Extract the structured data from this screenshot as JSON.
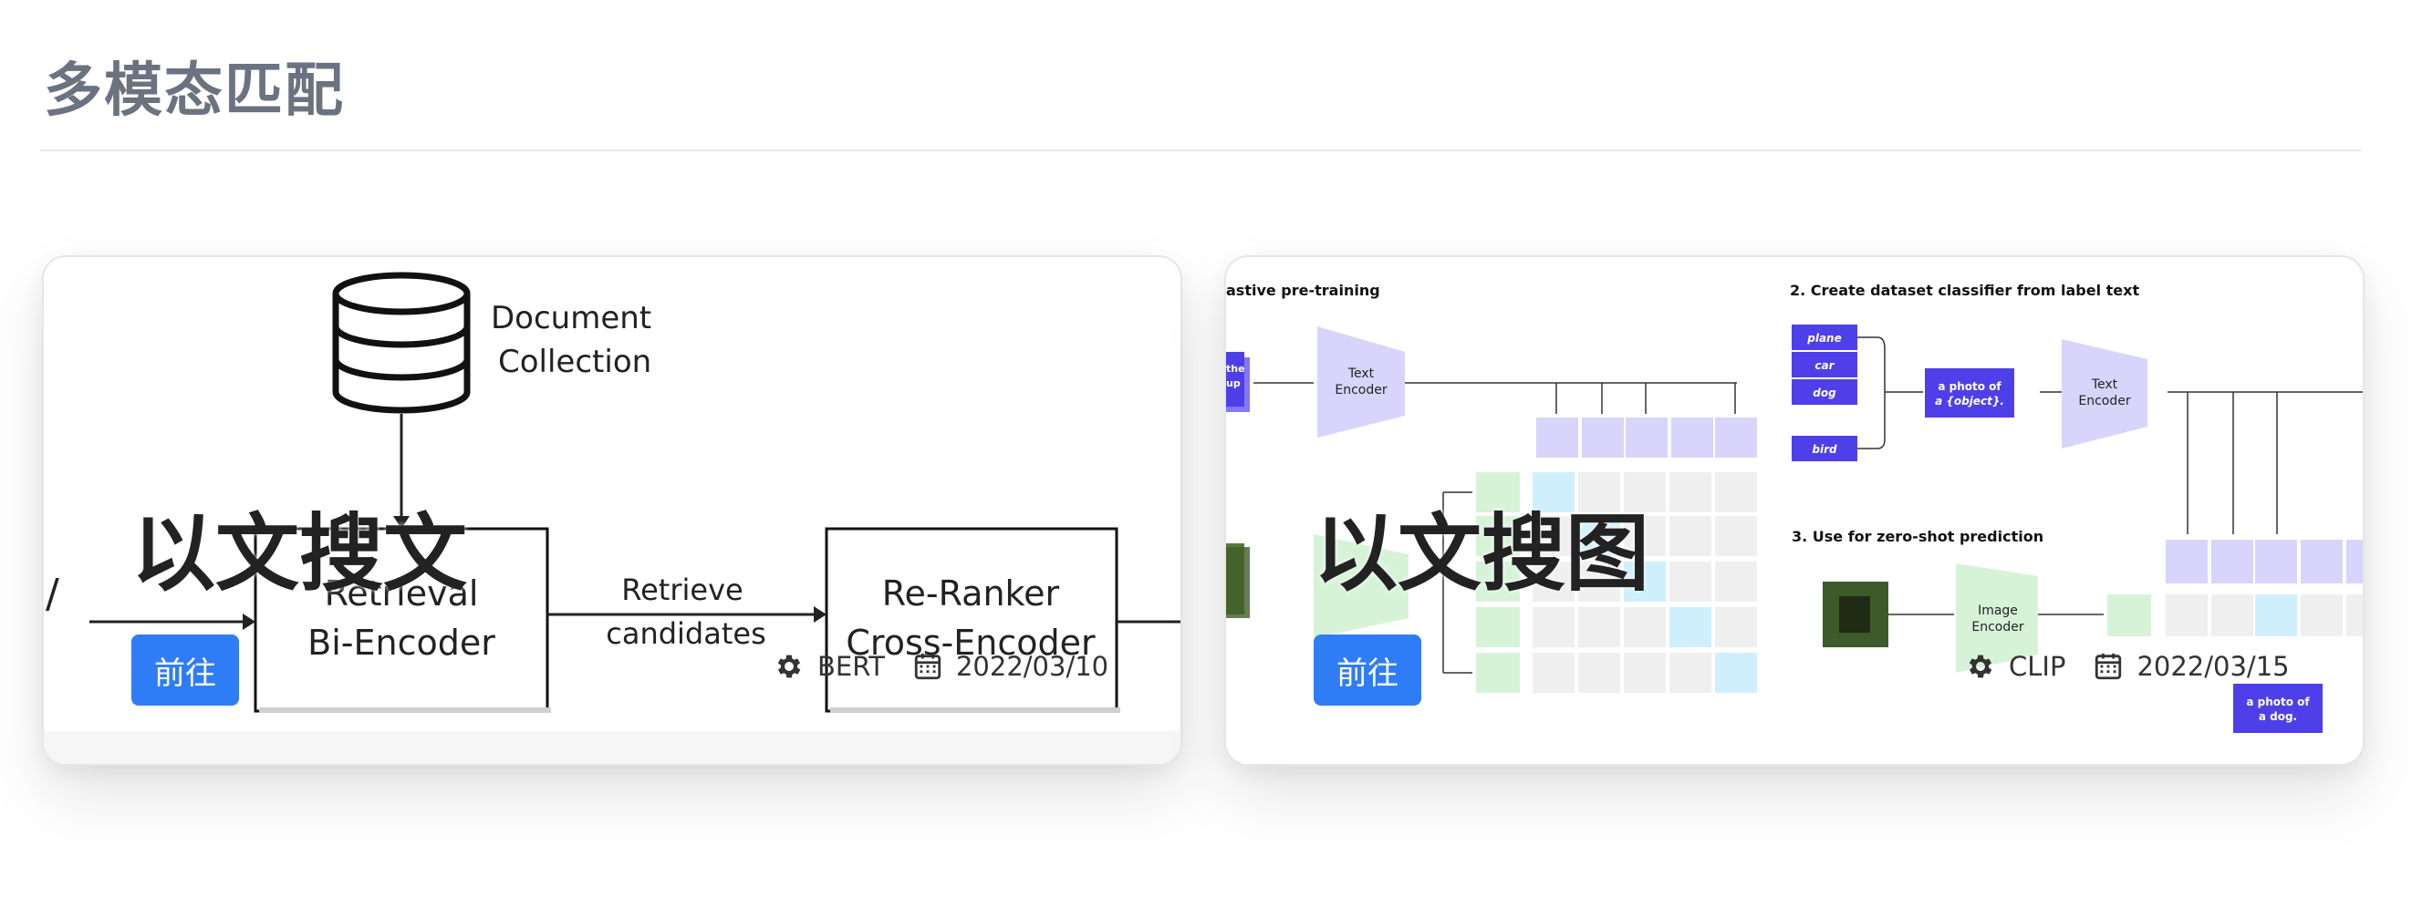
{
  "section": {
    "title": "多模态匹配"
  },
  "cards": [
    {
      "title": "以文搜文",
      "button_label": "前往",
      "model": "BERT",
      "date": "2022/03/10",
      "image_labels": {
        "doc": "Document",
        "collection": "Collection",
        "slash": "/",
        "retrieval": "Retrieval",
        "bi_encoder": "Bi-Encoder",
        "retrieve": "Retrieve",
        "candidates": "candidates",
        "reranker": "Re-Ranker",
        "cross_encoder": "Cross-Encoder"
      }
    },
    {
      "title": "以文搜图",
      "button_label": "前往",
      "model": "CLIP",
      "date": "2022/03/15",
      "image_labels": {
        "pretrain": "astive pre-training",
        "step2": "2. Create dataset classifier from label text",
        "step3": "3. Use for zero-shot prediction",
        "text_encoder": "Text",
        "encoder": "Encoder",
        "image_encoder": "Image",
        "plane": "plane",
        "car": "car",
        "dog": "dog",
        "bird": "bird",
        "photo1": "a photo of",
        "photo2": "a {object}.",
        "dog1": "a photo of",
        "dog2": "a dog.",
        "the": "the",
        "up": "up"
      }
    }
  ],
  "colors": {
    "accent": "#2f7df6",
    "title": "#6b7280",
    "clip_purple": "#4f3fe8",
    "clip_lavender": "#d8d4fb",
    "clip_green": "#d6f3d8",
    "clip_blue": "#cfeffd"
  },
  "icons": {
    "model": "gear-icon",
    "date": "calendar-icon"
  }
}
